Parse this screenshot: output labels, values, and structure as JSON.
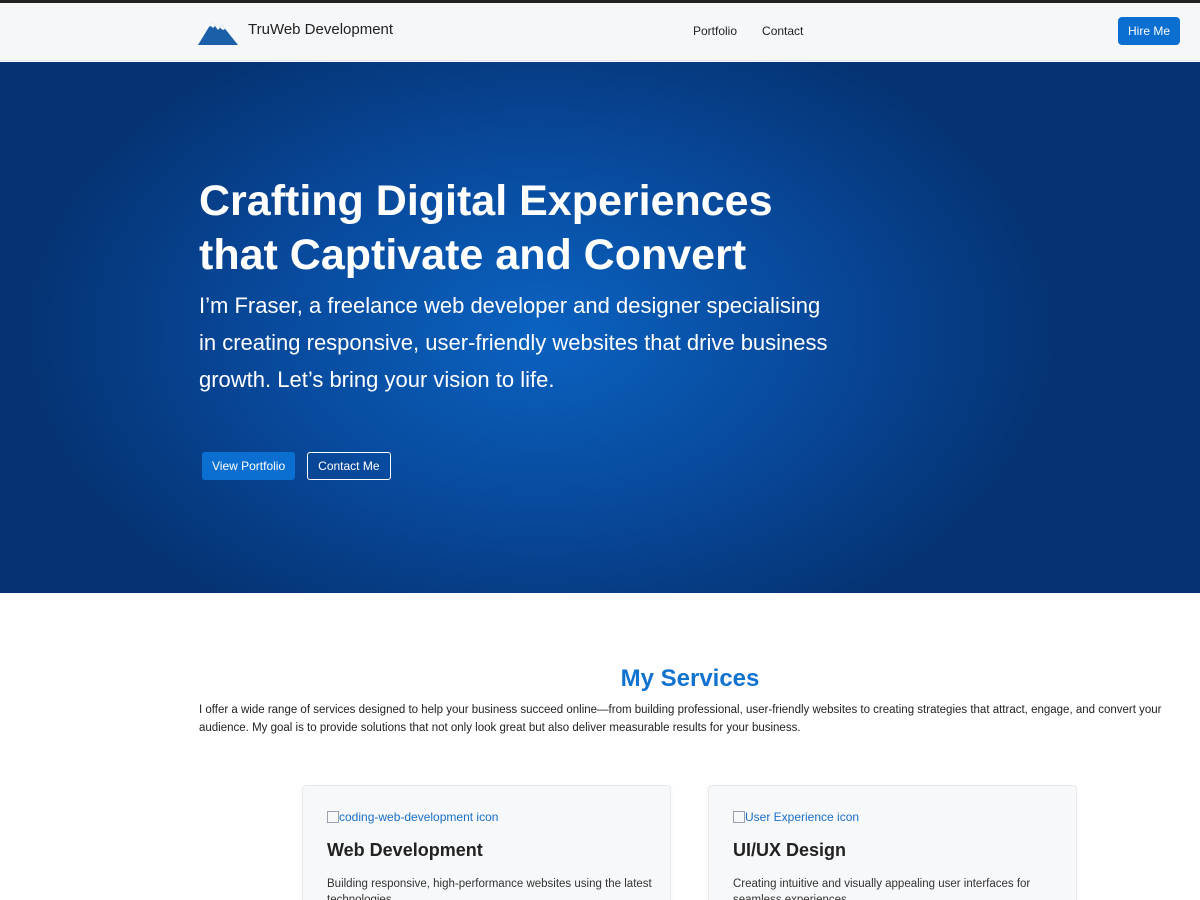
{
  "brand": {
    "name": "TruWeb Development",
    "logo_icon": "mountain-logo-icon",
    "logo_color": "#1a5fa8"
  },
  "nav": {
    "links": [
      "Portfolio",
      "Contact"
    ],
    "cta_label": "Hire Me"
  },
  "hero": {
    "title": "Crafting Digital Experiences that Captivate and Convert",
    "subtitle": "I’m Fraser, a freelance web developer and designer specialising in creating responsive, user-friendly websites that drive business growth. Let’s bring your vision to life.",
    "primary_button": "View Portfolio",
    "secondary_button": "Contact Me",
    "background_color": "#08489a"
  },
  "services": {
    "title": "My Services",
    "description": "I offer a wide range of services designed to help your business succeed online—from building professional, user-friendly websites to creating strategies that attract, engage, and convert your audience. My goal is to provide solutions that not only look great but also deliver measurable results for your business.",
    "cards": [
      {
        "icon_alt": "coding-web-development icon",
        "title": "Web Development",
        "text": "Building responsive, high-performance websites using the latest technologies."
      },
      {
        "icon_alt": "User Experience icon",
        "title": "UI/UX Design",
        "text": "Creating intuitive and visually appealing user interfaces for seamless experiences."
      }
    ]
  },
  "colors": {
    "accent": "#0a6fd1",
    "heading_blue": "#1172cf"
  }
}
